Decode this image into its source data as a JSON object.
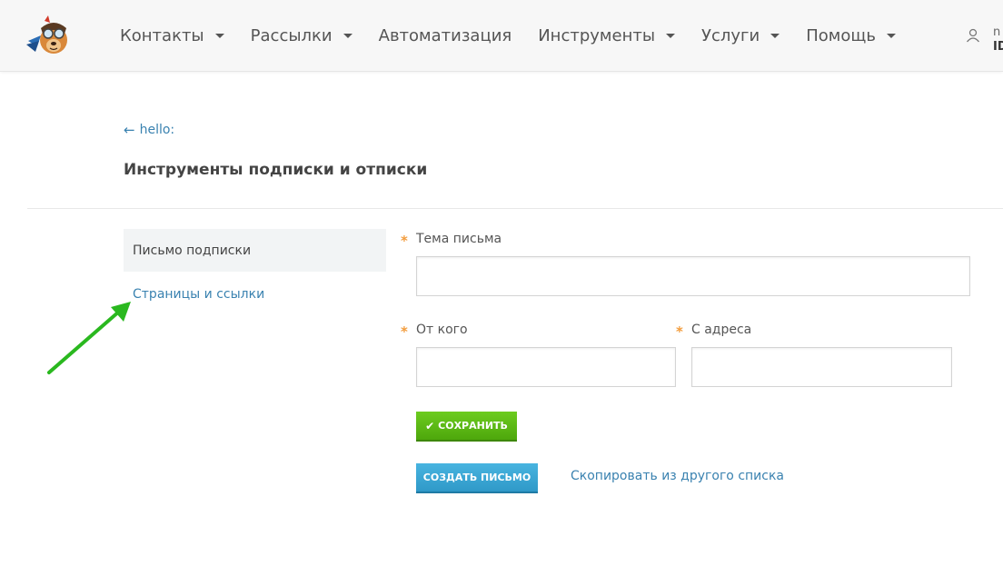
{
  "header": {
    "logo_icon": "dog-pilot-logo-icon",
    "nav": [
      {
        "label": "Контакты",
        "dropdown": true
      },
      {
        "label": "Рассылки",
        "dropdown": true
      },
      {
        "label": "Автоматизация",
        "dropdown": false
      },
      {
        "label": "Инструменты",
        "dropdown": true
      },
      {
        "label": "Услуги",
        "dropdown": true
      },
      {
        "label": "Помощь",
        "dropdown": true
      }
    ],
    "user": {
      "icon": "user-icon",
      "line1": "n",
      "line2": "ID"
    }
  },
  "breadcrumb": {
    "back_label": "hello:",
    "icon": "arrow-left-icon"
  },
  "page": {
    "title": "Инструменты подписки и отписки"
  },
  "sidebar": {
    "items": [
      {
        "label": "Письмо подписки",
        "active": true
      },
      {
        "label": "Страницы и ссылки",
        "active": false
      }
    ]
  },
  "form": {
    "subject": {
      "label": "Тема письма",
      "value": ""
    },
    "from_name": {
      "label": "От кого",
      "value": ""
    },
    "from_address": {
      "label": "С адреса",
      "value": ""
    },
    "required_mark": "*"
  },
  "actions": {
    "save_label": "СОХРАНИТЬ",
    "create_label": "СОЗДАТЬ ПИСЬМО",
    "copy_label": "Скопировать из другого списка"
  },
  "colors": {
    "link": "#3a82b0",
    "save_button": "#5ab815",
    "create_button": "#3aa7d6",
    "required": "#f39c3c",
    "annotation_arrow": "#2ab81f"
  }
}
